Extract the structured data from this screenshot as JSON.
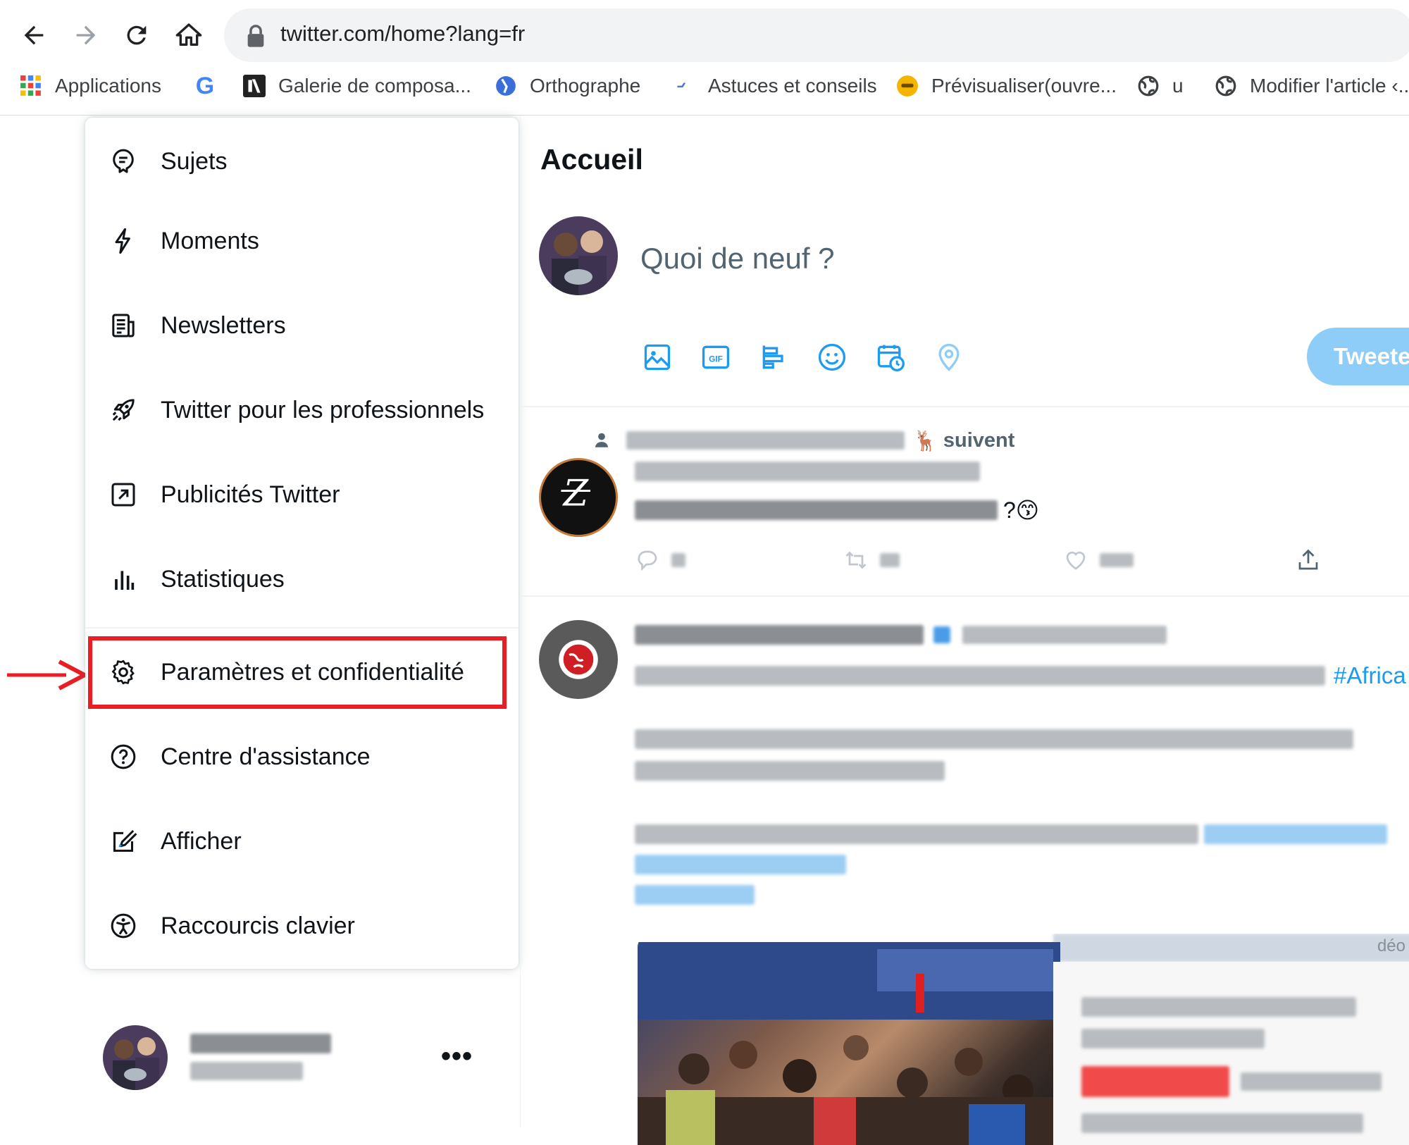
{
  "browser": {
    "url": "twitter.com/home?lang=fr",
    "bookmarks": [
      {
        "label": "Applications",
        "icon": "apps-grid-icon"
      },
      {
        "label": "",
        "icon": "google-icon"
      },
      {
        "label": "Galerie de composa...",
        "icon": "galerie-favicon"
      },
      {
        "label": "Orthographe",
        "icon": "orthographe-favicon"
      },
      {
        "label": "Astuces et conseils",
        "icon": "astuces-favicon"
      },
      {
        "label": "Prévisualiser(ouvre...",
        "icon": "previsualiser-favicon"
      },
      {
        "label": "u",
        "icon": "globe-icon"
      },
      {
        "label": "Modifier l'article ‹...",
        "icon": "globe-icon"
      }
    ]
  },
  "menu": {
    "items": [
      {
        "label": "Sujets",
        "icon": "topics-icon"
      },
      {
        "label": "Moments",
        "icon": "lightning-icon"
      },
      {
        "label": "Newsletters",
        "icon": "newsletter-icon"
      },
      {
        "label": "Twitter pour les professionnels",
        "icon": "rocket-icon"
      },
      {
        "label": "Publicités Twitter",
        "icon": "external-arrow-icon"
      },
      {
        "label": "Statistiques",
        "icon": "bar-chart-icon"
      },
      {
        "label": "Paramètres et confidentialité",
        "icon": "gear-icon"
      },
      {
        "label": "Centre d'assistance",
        "icon": "help-icon"
      },
      {
        "label": "Afficher",
        "icon": "edit-display-icon"
      },
      {
        "label": "Raccourcis clavier",
        "icon": "accessibility-icon"
      }
    ],
    "highlighted_index": 6
  },
  "account": {
    "more": "•••"
  },
  "main": {
    "title": "Accueil",
    "compose_placeholder": "Quoi de neuf ?",
    "tweet_button": "Tweeter",
    "tools": [
      "image-icon",
      "gif-icon",
      "poll-icon",
      "emoji-icon",
      "schedule-icon",
      "location-icon"
    ],
    "gif_label": "GIF"
  },
  "tweets": [
    {
      "social_context": "suivent",
      "line_end": "?😙"
    },
    {
      "hashtag": "#Africa",
      "video_label": "déo"
    }
  ],
  "colors": {
    "accent": "#1d9bf0",
    "tweet_button": "#8ecdf8",
    "highlight": "#ea1c24",
    "text_primary": "#0f1419",
    "text_secondary": "#536471"
  }
}
